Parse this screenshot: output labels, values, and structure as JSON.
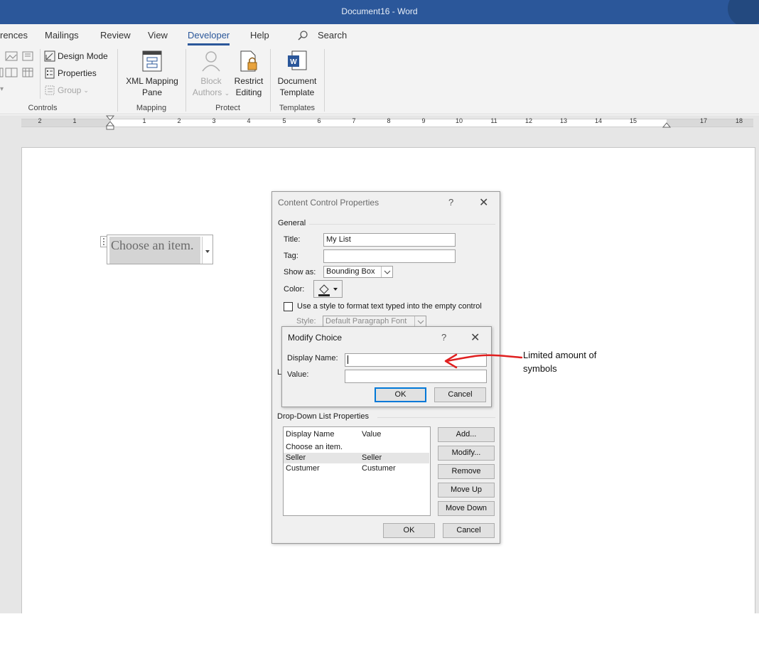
{
  "window": {
    "title": "Document16  -  Word"
  },
  "tabs": [
    "rences",
    "Mailings",
    "Review",
    "View",
    "Developer",
    "Help"
  ],
  "active_tab": "Developer",
  "search": {
    "label": "Search"
  },
  "ribbon": {
    "controls": {
      "design_mode": "Design Mode",
      "properties": "Properties",
      "group": "Group",
      "label": "Controls"
    },
    "mapping": {
      "xml_line1": "XML Mapping",
      "xml_line2": "Pane",
      "label": "Mapping"
    },
    "protect": {
      "block_line1": "Block",
      "block_line2": "Authors",
      "restrict_line1": "Restrict",
      "restrict_line2": "Editing",
      "label": "Protect"
    },
    "templates": {
      "doc_line1": "Document",
      "doc_line2": "Template",
      "label": "Templates"
    }
  },
  "ruler": {
    "numbers": [
      "2",
      "1",
      "1",
      "2",
      "3",
      "4",
      "5",
      "6",
      "7",
      "8",
      "9",
      "10",
      "11",
      "12",
      "13",
      "14",
      "15",
      "17",
      "18"
    ]
  },
  "document": {
    "content_control_text": "Choose an item."
  },
  "ccp_dialog": {
    "title": "Content Control Properties",
    "help": "?",
    "general_label": "General",
    "title_label": "Title:",
    "title_value": "My List",
    "tag_label": "Tag:",
    "tag_value": "",
    "show_as_label": "Show as:",
    "show_as_value": "Bounding Box",
    "color_label": "Color:",
    "use_style_label": "Use a style to format text typed into the empty control",
    "style_label": "Style:",
    "style_value": "Default Paragraph Font",
    "hidden_label_letter": "L",
    "dropdown_section": "Drop-Down List Properties",
    "list_header_display": "Display Name",
    "list_header_value": "Value",
    "list_rows": [
      {
        "display": "Choose an item.",
        "value": ""
      },
      {
        "display": "Seller",
        "value": "Seller"
      },
      {
        "display": "Custumer",
        "value": "Custumer"
      }
    ],
    "buttons": {
      "add": "Add...",
      "modify": "Modify...",
      "remove": "Remove",
      "move_up": "Move Up",
      "move_down": "Move Down",
      "ok": "OK",
      "cancel": "Cancel"
    }
  },
  "modify_dialog": {
    "title": "Modify Choice",
    "help": "?",
    "display_name_label": "Display Name:",
    "display_name_value": "",
    "value_label": "Value:",
    "value_value": "",
    "ok": "OK",
    "cancel": "Cancel"
  },
  "annotation": {
    "line1": "Limited amount of",
    "line2": "symbols",
    "color": "#e02020"
  },
  "colors": {
    "titlebar": "#2b579a",
    "accent": "#0078d7"
  }
}
